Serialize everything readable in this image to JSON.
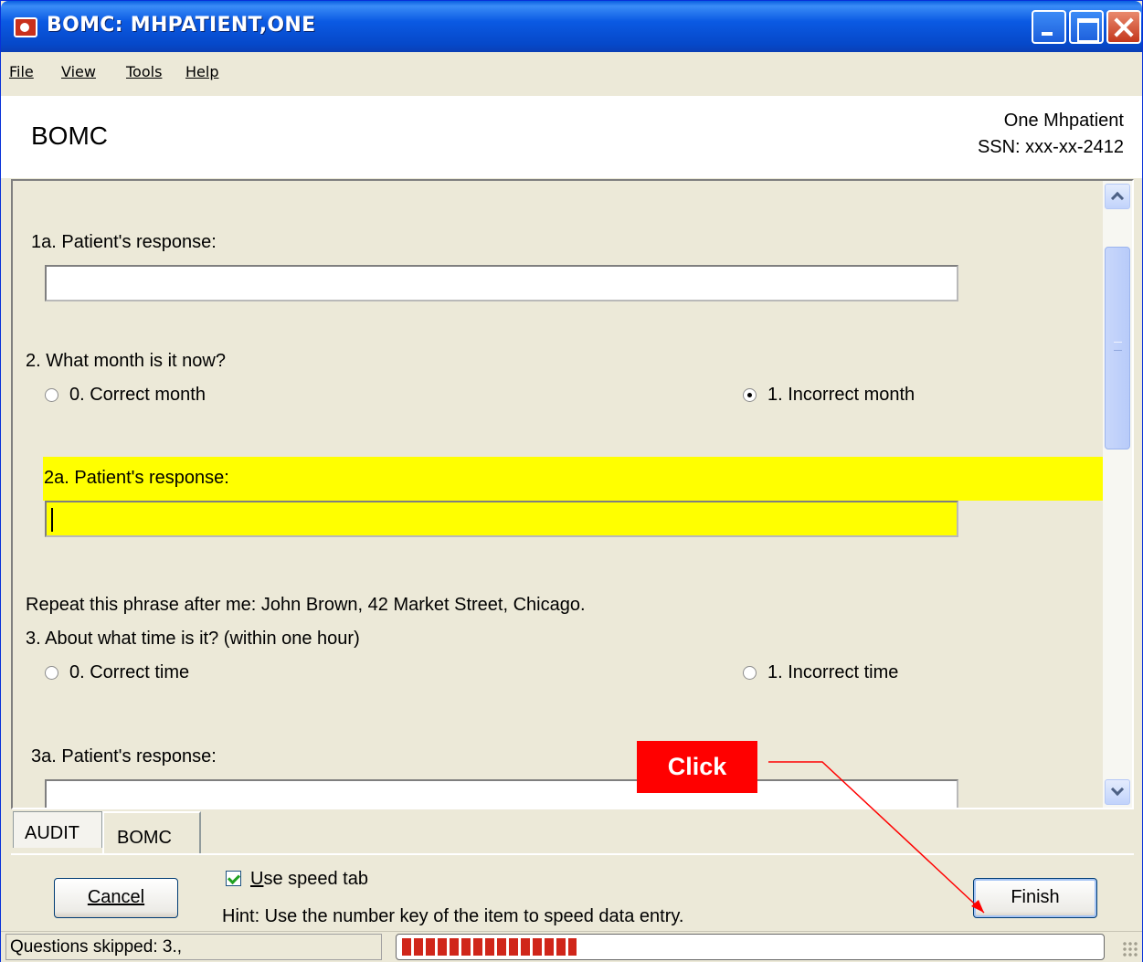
{
  "window": {
    "title": "BOMC: MHPATIENT,ONE"
  },
  "menu": {
    "items": [
      {
        "label": "File"
      },
      {
        "label": "View"
      },
      {
        "label": "Tools"
      },
      {
        "label": "Help"
      }
    ]
  },
  "header": {
    "title": "BOMC",
    "patient_name": "One Mhpatient",
    "ssn": "SSN: xxx-xx-2412"
  },
  "questions": {
    "q1a": {
      "label": "1a. Patient's response:",
      "value": ""
    },
    "q2": {
      "label": "2. What month is it now?",
      "options": [
        {
          "label": "0. Correct month",
          "checked": false
        },
        {
          "label": "1. Incorrect month",
          "checked": true
        }
      ]
    },
    "q2a": {
      "label": "2a. Patient's response:",
      "value": "",
      "highlight_color": "#ffff00"
    },
    "phrase": "Repeat this phrase after me: John Brown, 42 Market Street, Chicago.",
    "q3": {
      "label": "3. About what time is it? (within one hour)",
      "options": [
        {
          "label": "0. Correct time",
          "checked": false
        },
        {
          "label": "1. Incorrect time",
          "checked": false
        }
      ]
    },
    "q3a": {
      "label": "3a. Patient's response:",
      "value": ""
    }
  },
  "tabs": [
    {
      "label": "AUDIT",
      "active": false
    },
    {
      "label": "BOMC",
      "active": true
    }
  ],
  "footer": {
    "cancel_label": "Cancel",
    "finish_label": "Finish",
    "speed_tab_label": "Use speed tab",
    "speed_tab_checked": true,
    "hint": "Hint: Use the number key of the item to speed data entry."
  },
  "status": {
    "text": "Questions skipped: 3.,",
    "progress_fraction": 0.25
  },
  "annotation": {
    "callout_text": "Click",
    "color": "#ff0000"
  },
  "colors": {
    "titlebar": "#0b5ae3",
    "highlight": "#ffff00",
    "progress": "#d0261a"
  }
}
